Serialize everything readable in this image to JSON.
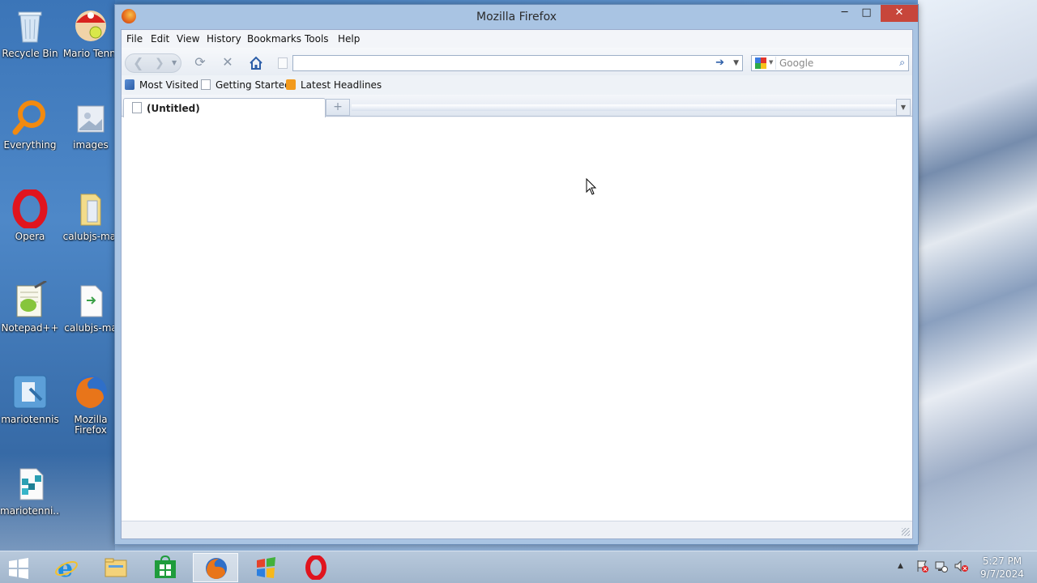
{
  "desktop": {
    "icons": [
      {
        "label": "Recycle Bin"
      },
      {
        "label": "Mario Tenni"
      },
      {
        "label": "Everything"
      },
      {
        "label": "images"
      },
      {
        "label": "Opera"
      },
      {
        "label": "calubjs-mai"
      },
      {
        "label": "Notepad++"
      },
      {
        "label": "calubjs-ma"
      },
      {
        "label": "mariotennis"
      },
      {
        "label": "Mozilla\nFirefox"
      },
      {
        "label": "mariotenni..."
      }
    ]
  },
  "window": {
    "title": "Mozilla Firefox",
    "controls": {
      "minimize": "─",
      "maximize": "□",
      "close": "✕"
    }
  },
  "menu": {
    "items": [
      "File",
      "Edit",
      "View",
      "History",
      "Bookmarks",
      "Tools",
      "Help"
    ]
  },
  "navbar": {
    "url_value": "",
    "search_placeholder": "Google"
  },
  "bookmarks": {
    "items": [
      "Most Visited",
      "Getting Started",
      "Latest Headlines"
    ]
  },
  "tabs": {
    "items": [
      {
        "label": "(Untitled)"
      }
    ],
    "new_tab": "+"
  },
  "taskbar": {
    "clock_time": "5:27 PM",
    "clock_date": "9/7/2024",
    "tray_arrow": "▲"
  },
  "colors": {
    "close_button": "#c7463b",
    "window_frame": "#a9c4e3"
  }
}
